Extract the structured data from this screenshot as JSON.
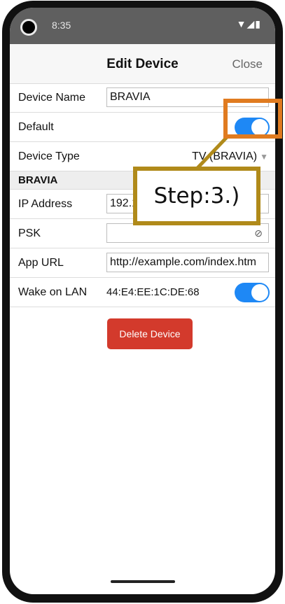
{
  "status_bar": {
    "time": "8:35",
    "icons": [
      "wifi-icon",
      "signal-icon",
      "battery-icon"
    ]
  },
  "header": {
    "title": "Edit Device",
    "close_label": "Close"
  },
  "form": {
    "device_name": {
      "label": "Device Name",
      "value": "BRAVIA"
    },
    "default": {
      "label": "Default",
      "on": true
    },
    "device_type": {
      "label": "Device Type",
      "value": "TV (BRAVIA)"
    },
    "section_title": "BRAVIA",
    "ip_address": {
      "label": "IP Address",
      "value": "192.168.0.1"
    },
    "psk": {
      "label": "PSK",
      "value": ""
    },
    "app_url": {
      "label": "App URL",
      "value": "http://example.com/index.htm"
    },
    "wake_on_lan": {
      "label": "Wake on LAN",
      "mac": "44:E4:EE:1C:DE:68",
      "on": true
    }
  },
  "actions": {
    "delete_label": "Delete Device"
  },
  "annotation": {
    "step_label": "Step:3.)"
  },
  "colors": {
    "accent": "#1e88f5",
    "danger": "#d33a2c",
    "callout_orange": "#e07b20",
    "callout_gold": "#b08a1a"
  }
}
